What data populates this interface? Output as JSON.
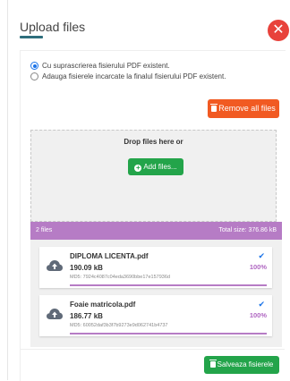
{
  "header": {
    "title": "Upload files",
    "close_symbol": "✕"
  },
  "options": {
    "overwrite_label": "Cu suprascrierea fisierului PDF existent.",
    "append_label": "Adauga fisierele incarcate la finalul fisierului PDF existent.",
    "selected": "overwrite"
  },
  "toolbar": {
    "remove_all_label": "Remove all files"
  },
  "dropzone": {
    "text": "Drop files here or",
    "add_label": "Add files..."
  },
  "status": {
    "count": "2 files",
    "total": "Total size: 376.86 kB"
  },
  "files": [
    {
      "name": "DIPLOMA LICENTA.pdf",
      "size": "190.09 kB",
      "md5": "MD5: 7924c4087c04eda3690bbe17e157936d",
      "percent": "100%",
      "progress": 1.0
    },
    {
      "name": "Foaie matricola.pdf",
      "size": "186.77 kB",
      "md5": "MD5: 60052daf3b3f7b9273e9d062741b4737",
      "percent": "100%",
      "progress": 1.0
    }
  ],
  "footer": {
    "save_label": "Salveaza fisierele"
  },
  "colors": {
    "close": "#e8423b",
    "remove": "#f15a22",
    "add": "#23a44a",
    "save": "#23a44a",
    "status_bar": "#b67cc5",
    "check": "#1a73e8",
    "accent_underline": "#2e6e7c"
  },
  "icons": {
    "close": "close-icon",
    "remove": "trash-icon",
    "add": "plus-circle-icon",
    "save": "trash-icon",
    "file": "cloud-upload-icon",
    "check": "checkmark-icon"
  }
}
